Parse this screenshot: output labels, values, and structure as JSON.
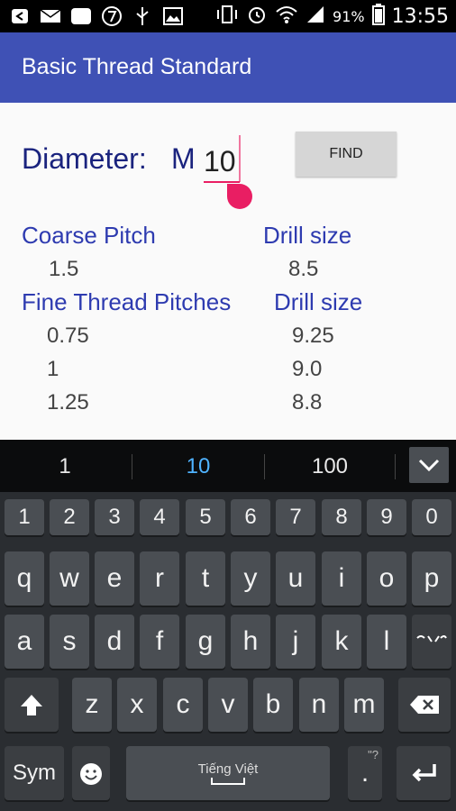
{
  "status_bar": {
    "battery_text": "91%",
    "time": "13:55",
    "icons": [
      "back-icon",
      "mail-icon",
      "zalo-icon",
      "seven-icon",
      "usb-icon",
      "image-icon",
      "vibrate-icon",
      "alarm-icon",
      "wifi-icon",
      "signal-icon",
      "battery-icon"
    ]
  },
  "app_bar": {
    "title": "Basic Thread Standard"
  },
  "form": {
    "diameter_label": "Diameter:",
    "prefix": "M",
    "value": "10",
    "find_label": "FIND"
  },
  "coarse": {
    "header": "Coarse Pitch",
    "drill_header": "Drill size",
    "pitch": "1.5",
    "drill": "8.5"
  },
  "fine": {
    "header": "Fine Thread Pitches",
    "drill_header": "Drill size",
    "rows": [
      {
        "pitch": "0.75",
        "drill": "9.25"
      },
      {
        "pitch": "1",
        "drill": "9.0"
      },
      {
        "pitch": "1.25",
        "drill": "8.8"
      }
    ]
  },
  "keyboard": {
    "suggestions": [
      "1",
      "10",
      "100"
    ],
    "selected_suggestion_color": "#4fb3ff",
    "numbers": [
      "1",
      "2",
      "3",
      "4",
      "5",
      "6",
      "7",
      "8",
      "9",
      "0"
    ],
    "row1": [
      "q",
      "w",
      "e",
      "r",
      "t",
      "y",
      "u",
      "i",
      "o",
      "p"
    ],
    "row2": [
      "a",
      "s",
      "d",
      "f",
      "g",
      "h",
      "j",
      "k",
      "l"
    ],
    "row3": [
      "z",
      "x",
      "c",
      "v",
      "b",
      "n",
      "m"
    ],
    "sym_label": "Sym",
    "space_label": "Tiếng Việt",
    "period_label": ".",
    "period_hint": "\"?"
  },
  "colors": {
    "app_bar": "#3f51b5",
    "accent": "#e91e63",
    "header_text": "#2e3bb0"
  }
}
